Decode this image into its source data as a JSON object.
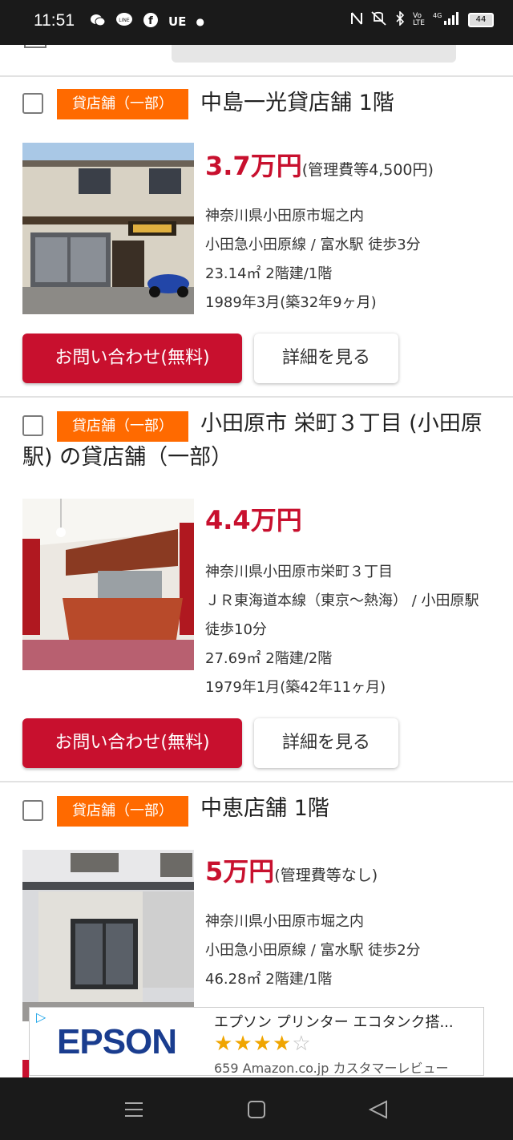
{
  "status_bar": {
    "time": "11:51",
    "left_icons": [
      "wechat-icon",
      "line-icon",
      "facebook-icon",
      "UE",
      "dot"
    ],
    "network": "4G",
    "battery": "44"
  },
  "listings": [
    {
      "tag": "貸店舗（一部）",
      "title": "中島一光貸店舗 1階",
      "price": "3.7万円",
      "fee": "(管理費等4,500円)",
      "address": "神奈川県小田原市堀之内",
      "access": "小田急小田原線 / 富水駅 徒歩3分",
      "size": "23.14㎡ 2階建/1階",
      "built": "1989年3月(築32年9ヶ月)",
      "contact_button": "お問い合わせ(無料)",
      "detail_button": "詳細を見る",
      "photo_icon": "two-storey-shop-photo"
    },
    {
      "tag": "貸店舗（一部）",
      "title": "小田原市 栄町３丁目 (小田原駅) の貸店舗（一部）",
      "price": "4.4万円",
      "fee": "",
      "address": "神奈川県小田原市栄町３丁目",
      "access": "ＪＲ東海道本線（東京～熱海） / 小田原駅 徒歩10分",
      "size": "27.69㎡ 2階建/2階",
      "built": "1979年1月(築42年11ヶ月)",
      "contact_button": "お問い合わせ(無料)",
      "detail_button": "詳細を見る",
      "photo_icon": "bar-interior-photo"
    },
    {
      "tag": "貸店舗（一部）",
      "title": "中恵店舗 1階",
      "price": "5万円",
      "fee": "(管理費等なし)",
      "address": "神奈川県小田原市堀之内",
      "access": "小田急小田原線 / 富水駅 徒歩2分",
      "size": "46.28㎡ 2階建/1階",
      "built": "",
      "photo_icon": "shop-front-photo"
    }
  ],
  "ad": {
    "brand": "EPSON",
    "title": "エプソン プリンター エコタンク搭...",
    "rating": 4,
    "rating_max": 5,
    "review_text": "659 Amazon.co.jp カスタマーレビュー"
  },
  "nav_bar": {
    "icons": [
      "menu-icon",
      "home-icon",
      "back-icon"
    ]
  }
}
